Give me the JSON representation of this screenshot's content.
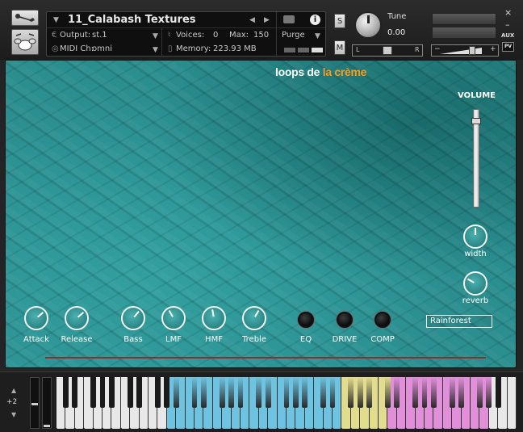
{
  "header": {
    "instrument_name": "11_Calabash Textures",
    "output_label": "Output:",
    "output_value": "st.1",
    "voices_label": "Voices:",
    "voices_value": "0",
    "max_label": "Max:",
    "max_value": "150",
    "midi_label": "MIDI Ch:",
    "midi_value": "omni",
    "memory_label": "Memory:",
    "memory_value": "223.93 MB",
    "purge_label": "Purge",
    "solo_label": "S",
    "mute_label": "M",
    "tune_label": "Tune",
    "tune_value": "0.00",
    "pan_left": "L",
    "pan_right": "R",
    "aux_label": "AUX",
    "pv_label": "PV",
    "close_glyph": "×",
    "minimize_glyph": "–"
  },
  "panel": {
    "logo_part1": "loops de ",
    "logo_part2": "la crème",
    "volume_label": "VOLUME",
    "volume_level": 0.92,
    "width_label": "width",
    "reverb_label": "reverb",
    "knobs": [
      {
        "label": "Attack"
      },
      {
        "label": "Release"
      },
      {
        "label": "Bass"
      },
      {
        "label": "LMF"
      },
      {
        "label": "HMF"
      },
      {
        "label": "Treble"
      }
    ],
    "fx_buttons": [
      {
        "label": "EQ"
      },
      {
        "label": "DRIVE"
      },
      {
        "label": "COMP"
      }
    ],
    "preset_value": "Rainforest"
  },
  "keyboard": {
    "octave_label": "+2",
    "colors": {
      "blue": "#6ec3e0",
      "yellow": "#e2dc8e",
      "pink": "#e28fda",
      "white": "#e8e8e8",
      "black": "#1a1a1a"
    }
  },
  "colors": {
    "panel_teal": "#2b8e8f",
    "logo_orange": "#ff9a1a",
    "line_red": "#8b2e2e"
  }
}
